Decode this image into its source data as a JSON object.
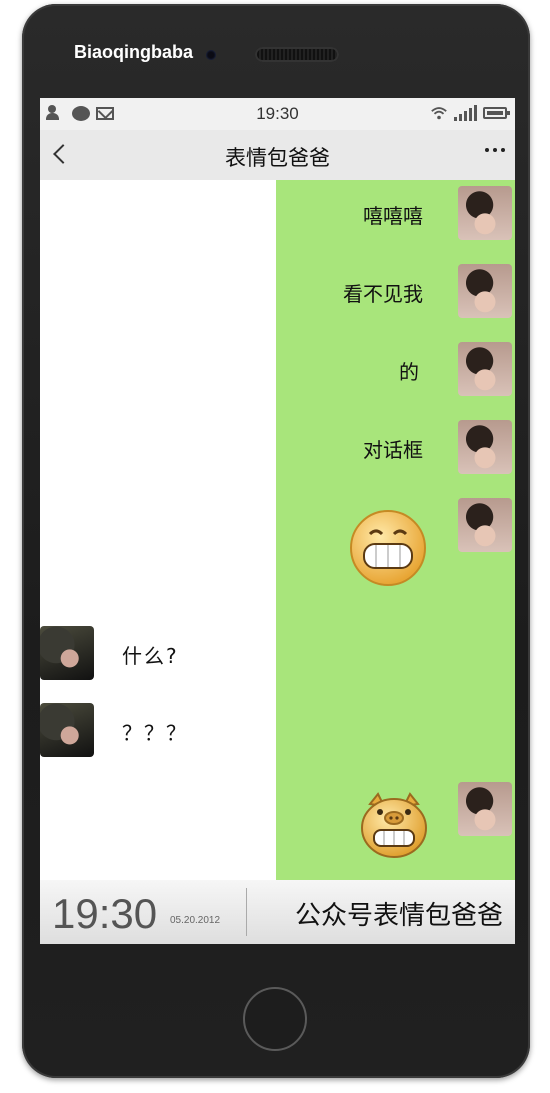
{
  "phone": {
    "brand": "Biaoqingbaba"
  },
  "status_bar": {
    "time": "19:30"
  },
  "header": {
    "title": "表情包爸爸"
  },
  "messages_right": [
    {
      "text": "嘻嘻嘻"
    },
    {
      "text": "看不见我"
    },
    {
      "text": "的"
    },
    {
      "text": "对话框"
    }
  ],
  "messages_left": [
    {
      "text": "什么?"
    },
    {
      "text": "？？？"
    }
  ],
  "bottom_bar": {
    "time": "19:30",
    "date": "05.20.2012",
    "caption": "公众号表情包爸爸"
  },
  "colors": {
    "chat_green": "#a8e57b",
    "phone_body": "#1f1f1f"
  }
}
